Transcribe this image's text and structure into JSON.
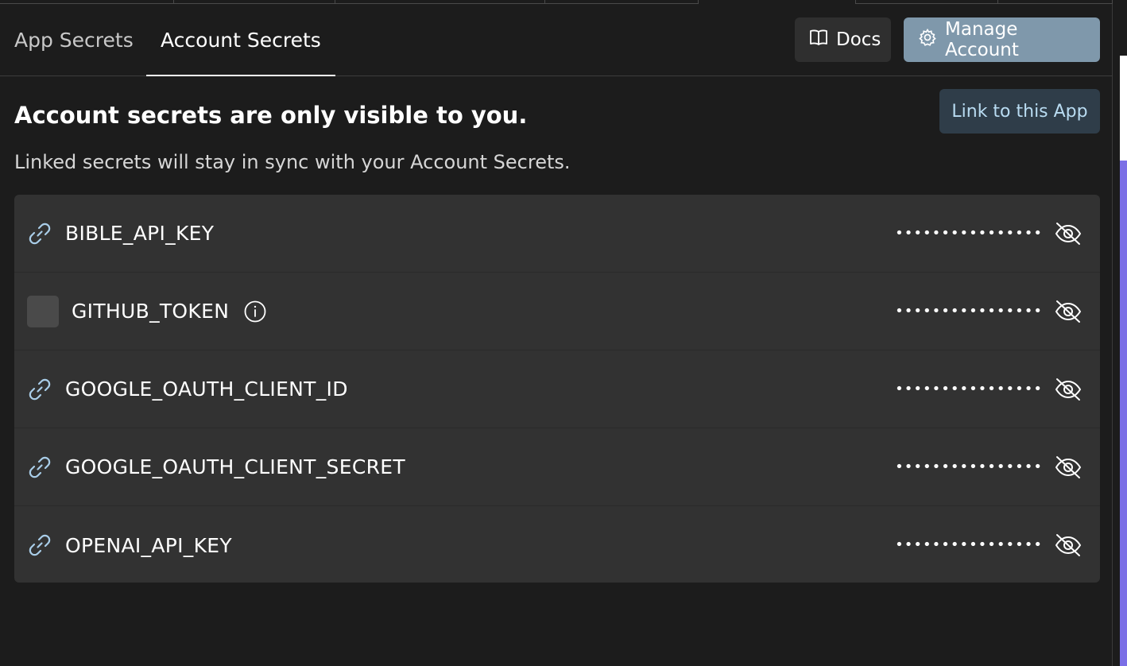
{
  "tabs": [
    {
      "label": "App Secrets",
      "active": false
    },
    {
      "label": "Account Secrets",
      "active": true
    }
  ],
  "toolbar": {
    "docs_label": "Docs",
    "manage_label": "Manage Account"
  },
  "content": {
    "heading": "Account secrets are only visible to you.",
    "subtext": "Linked secrets will stay in sync with your Account Secrets.",
    "link_button": "Link to this App"
  },
  "secrets": [
    {
      "name": "BIBLE_API_KEY",
      "linked": true,
      "value_masked": "••••••••••••••••",
      "icon": "link-icon"
    },
    {
      "name": "GITHUB_TOKEN",
      "linked": false,
      "value_masked": "••••••••••••••••",
      "icon": "checkbox",
      "info": true
    },
    {
      "name": "GOOGLE_OAUTH_CLIENT_ID",
      "linked": true,
      "value_masked": "••••••••••••••••",
      "icon": "link-icon"
    },
    {
      "name": "GOOGLE_OAUTH_CLIENT_SECRET",
      "linked": true,
      "value_masked": "••••••••••••••••",
      "icon": "link-icon"
    },
    {
      "name": "OPENAI_API_KEY",
      "linked": true,
      "value_masked": "••••••••••••••••",
      "icon": "link-icon"
    }
  ],
  "colors": {
    "background": "#1c1c1c",
    "list_bg": "#323232",
    "manage_button": "#7f98ab",
    "link_button_bg": "#2f3d49",
    "link_button_text": "#b9dcf2",
    "link_icon": "#a9cde8",
    "accent_purple": "#7b6fe6"
  }
}
